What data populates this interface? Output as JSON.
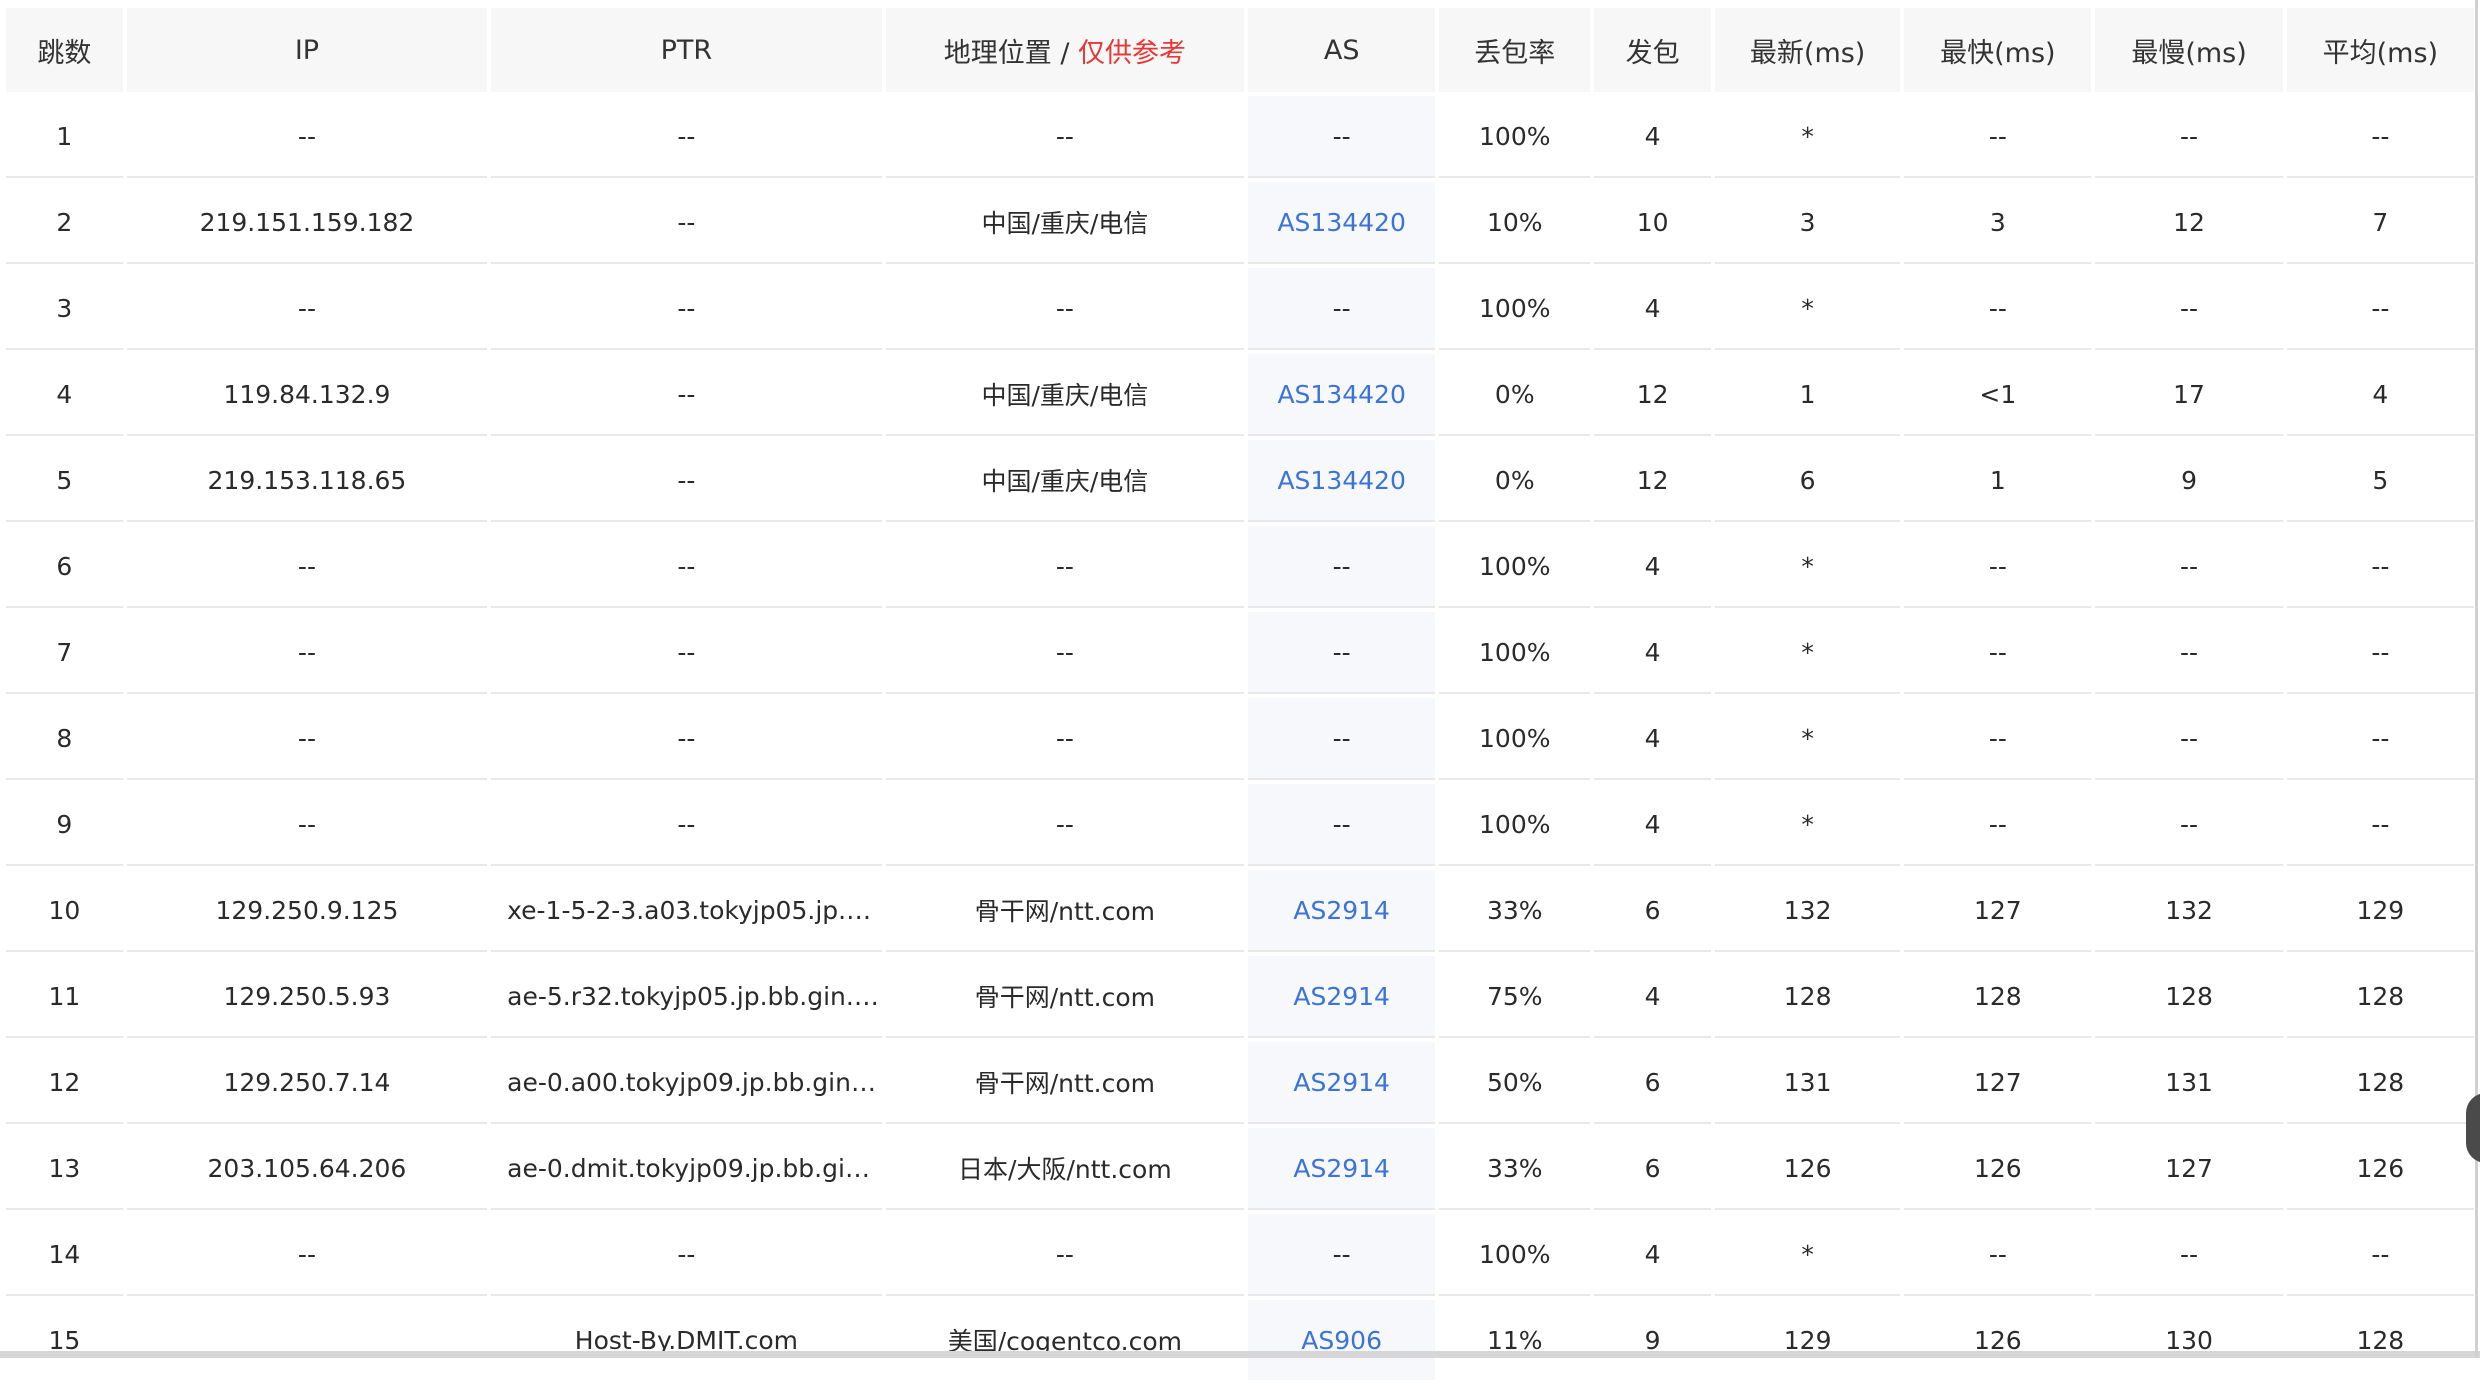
{
  "table": {
    "headers": {
      "hop": "跳数",
      "ip": "IP",
      "ptr": "PTR",
      "geo": "地理位置 / ",
      "geo_note": "仅供参考",
      "as": "AS",
      "loss": "丢包率",
      "sent": "发包",
      "last": "最新(ms)",
      "best": "最快(ms)",
      "worst": "最慢(ms)",
      "avg": "平均(ms)"
    },
    "rows": [
      {
        "hop": "1",
        "ip": "--",
        "ptr": "--",
        "geo": "--",
        "as": "--",
        "loss": "100%",
        "sent": "4",
        "last": "*",
        "best": "--",
        "worst": "--",
        "avg": "--"
      },
      {
        "hop": "2",
        "ip": "219.151.159.182",
        "ptr": "--",
        "geo": "中国/重庆/电信",
        "as": "AS134420",
        "loss": "10%",
        "sent": "10",
        "last": "3",
        "best": "3",
        "worst": "12",
        "avg": "7"
      },
      {
        "hop": "3",
        "ip": "--",
        "ptr": "--",
        "geo": "--",
        "as": "--",
        "loss": "100%",
        "sent": "4",
        "last": "*",
        "best": "--",
        "worst": "--",
        "avg": "--"
      },
      {
        "hop": "4",
        "ip": "119.84.132.9",
        "ptr": "--",
        "geo": "中国/重庆/电信",
        "as": "AS134420",
        "loss": "0%",
        "sent": "12",
        "last": "1",
        "best": "<1",
        "worst": "17",
        "avg": "4"
      },
      {
        "hop": "5",
        "ip": "219.153.118.65",
        "ptr": "--",
        "geo": "中国/重庆/电信",
        "as": "AS134420",
        "loss": "0%",
        "sent": "12",
        "last": "6",
        "best": "1",
        "worst": "9",
        "avg": "5"
      },
      {
        "hop": "6",
        "ip": "--",
        "ptr": "--",
        "geo": "--",
        "as": "--",
        "loss": "100%",
        "sent": "4",
        "last": "*",
        "best": "--",
        "worst": "--",
        "avg": "--"
      },
      {
        "hop": "7",
        "ip": "--",
        "ptr": "--",
        "geo": "--",
        "as": "--",
        "loss": "100%",
        "sent": "4",
        "last": "*",
        "best": "--",
        "worst": "--",
        "avg": "--"
      },
      {
        "hop": "8",
        "ip": "--",
        "ptr": "--",
        "geo": "--",
        "as": "--",
        "loss": "100%",
        "sent": "4",
        "last": "*",
        "best": "--",
        "worst": "--",
        "avg": "--"
      },
      {
        "hop": "9",
        "ip": "--",
        "ptr": "--",
        "geo": "--",
        "as": "--",
        "loss": "100%",
        "sent": "4",
        "last": "*",
        "best": "--",
        "worst": "--",
        "avg": "--"
      },
      {
        "hop": "10",
        "ip": "129.250.9.125",
        "ptr": "xe-1-5-2-3.a03.tokyjp05.jp.b...",
        "geo": "骨干网/ntt.com",
        "as": "AS2914",
        "loss": "33%",
        "sent": "6",
        "last": "132",
        "best": "127",
        "worst": "132",
        "avg": "129"
      },
      {
        "hop": "11",
        "ip": "129.250.5.93",
        "ptr": "ae-5.r32.tokyjp05.jp.bb.gin.n...",
        "geo": "骨干网/ntt.com",
        "as": "AS2914",
        "loss": "75%",
        "sent": "4",
        "last": "128",
        "best": "128",
        "worst": "128",
        "avg": "128"
      },
      {
        "hop": "12",
        "ip": "129.250.7.14",
        "ptr": "ae-0.a00.tokyjp09.jp.bb.gin.n...",
        "geo": "骨干网/ntt.com",
        "as": "AS2914",
        "loss": "50%",
        "sent": "6",
        "last": "131",
        "best": "127",
        "worst": "131",
        "avg": "128"
      },
      {
        "hop": "13",
        "ip": "203.105.64.206",
        "ptr": "ae-0.dmit.tokyjp09.jp.bb.gin....",
        "geo": "日本/大阪/ntt.com",
        "as": "AS2914",
        "loss": "33%",
        "sent": "6",
        "last": "126",
        "best": "126",
        "worst": "127",
        "avg": "126"
      },
      {
        "hop": "14",
        "ip": "--",
        "ptr": "--",
        "geo": "--",
        "as": "--",
        "loss": "100%",
        "sent": "4",
        "last": "*",
        "best": "--",
        "worst": "--",
        "avg": "--"
      },
      {
        "hop": "15",
        "ip": "",
        "ptr": "Host-By.DMIT.com",
        "geo": "美国/cogentco.com",
        "as": "AS906",
        "loss": "11%",
        "sent": "9",
        "last": "129",
        "best": "126",
        "worst": "130",
        "avg": "128"
      }
    ]
  },
  "colors": {
    "as_link": "#3b73d9",
    "geo_note": "#e53935",
    "header_bg": "#f7f7f7"
  }
}
